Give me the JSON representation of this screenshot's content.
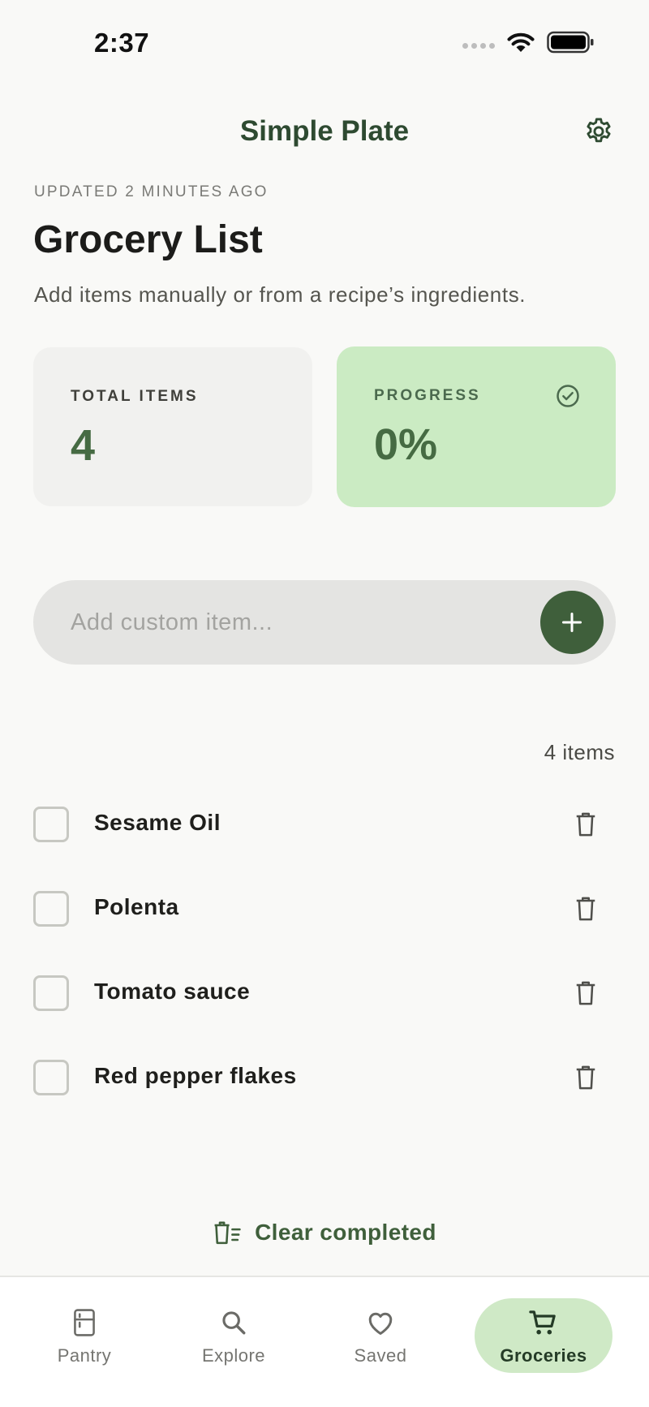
{
  "status_bar": {
    "time": "2:37"
  },
  "header": {
    "title": "Simple Plate",
    "settings_icon": "gear-icon"
  },
  "page": {
    "updated": "UPDATED 2 MINUTES AGO",
    "title": "Grocery List",
    "subtitle": "Add items manually or from a recipe’s ingredients."
  },
  "stats": {
    "total_label": "TOTAL ITEMS",
    "total_value": "4",
    "progress_label": "PROGRESS",
    "progress_value": "0%"
  },
  "add_item": {
    "placeholder": "Add custom item..."
  },
  "list": {
    "count_label": "4 items",
    "items": [
      {
        "label": "Sesame Oil",
        "checked": false
      },
      {
        "label": "Polenta",
        "checked": false
      },
      {
        "label": "Tomato sauce",
        "checked": false
      },
      {
        "label": "Red pepper flakes",
        "checked": false
      }
    ]
  },
  "clear_completed": {
    "label": "Clear completed"
  },
  "nav": {
    "items": [
      {
        "label": "Pantry",
        "icon": "fridge-icon",
        "active": false
      },
      {
        "label": "Explore",
        "icon": "search-icon",
        "active": false
      },
      {
        "label": "Saved",
        "icon": "heart-icon",
        "active": false
      },
      {
        "label": "Groceries",
        "icon": "cart-icon",
        "active": true
      }
    ]
  },
  "colors": {
    "brand_dark_green": "#3f5f3b",
    "title_green": "#2e4a31",
    "progress_card_bg": "#cbebc3",
    "active_nav_bg": "#cfe9c6",
    "background": "#f9f9f7"
  }
}
